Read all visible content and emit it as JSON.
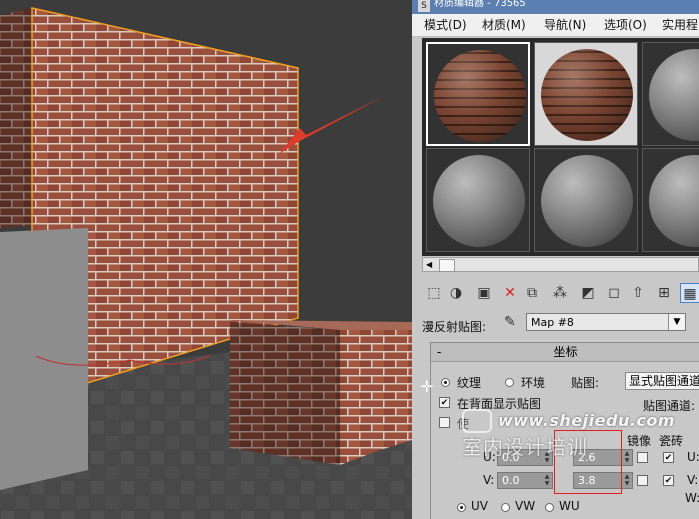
{
  "window": {
    "title": "材质编辑器 - 73565",
    "icon_text": "S"
  },
  "menu": [
    "模式(D)",
    "材质(M)",
    "导航(N)",
    "选项(O)",
    "实用程"
  ],
  "diffuse": {
    "label": "漫反射贴图:",
    "map_name": "Map #8"
  },
  "rollout": {
    "title": "坐标",
    "mapping_options": [
      "纹理",
      "环境"
    ],
    "mapping_selected": "纹理",
    "map_label": "贴图:",
    "map_value": "显式贴图通道",
    "show_on_back_label": "在背面显示贴图",
    "show_on_back_checked": true,
    "map_channel_label": "贴图通道:",
    "mirror_header": "镜像",
    "tile_header": "瓷砖",
    "rows": [
      {
        "axis": "U:",
        "offset": "0.0",
        "tiling": "2.6",
        "mirror": false,
        "tile": true
      },
      {
        "axis": "V:",
        "offset": "0.0",
        "tiling": "3.8",
        "mirror": false,
        "tile": true
      }
    ],
    "extra_axes": [
      "U:",
      "V:",
      "W:"
    ],
    "uvw_options": [
      "UV",
      "VW",
      "WU"
    ],
    "uvw_selected": "UV"
  },
  "watermark": {
    "url": "www.shejiedu.com",
    "text": "室内设计培训"
  },
  "colors": {
    "arrow": "#e03a2a",
    "wall_outline": "#f0a020",
    "highlight": "#e02020"
  }
}
